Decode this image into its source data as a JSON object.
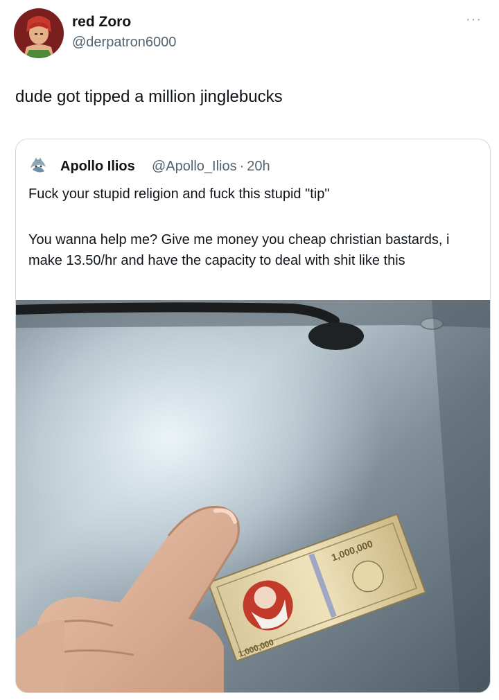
{
  "tweet": {
    "author_name": "red Zoro",
    "author_handle": "@derpatron6000",
    "more_icon": "more-horizontal-icon",
    "more_glyph": "···",
    "text": "dude got tipped a million jinglebucks"
  },
  "quote": {
    "author_name": "Apollo Ilios",
    "author_handle": "@Apollo_Ilios",
    "separator": "·",
    "time": "20h",
    "text_line1": "Fuck your stupid religion and fuck this stupid \"tip\"",
    "text_paragraph2": "You wanna help me? Give me money you cheap christian bastards, i make 13.50/hr and have the capacity to deal with shit like this",
    "bill_denomination": "1,000,000",
    "bill_corner": "1,000,000"
  },
  "colors": {
    "text_primary": "#0f1419",
    "text_secondary": "#536471",
    "border": "#cfd9de"
  }
}
